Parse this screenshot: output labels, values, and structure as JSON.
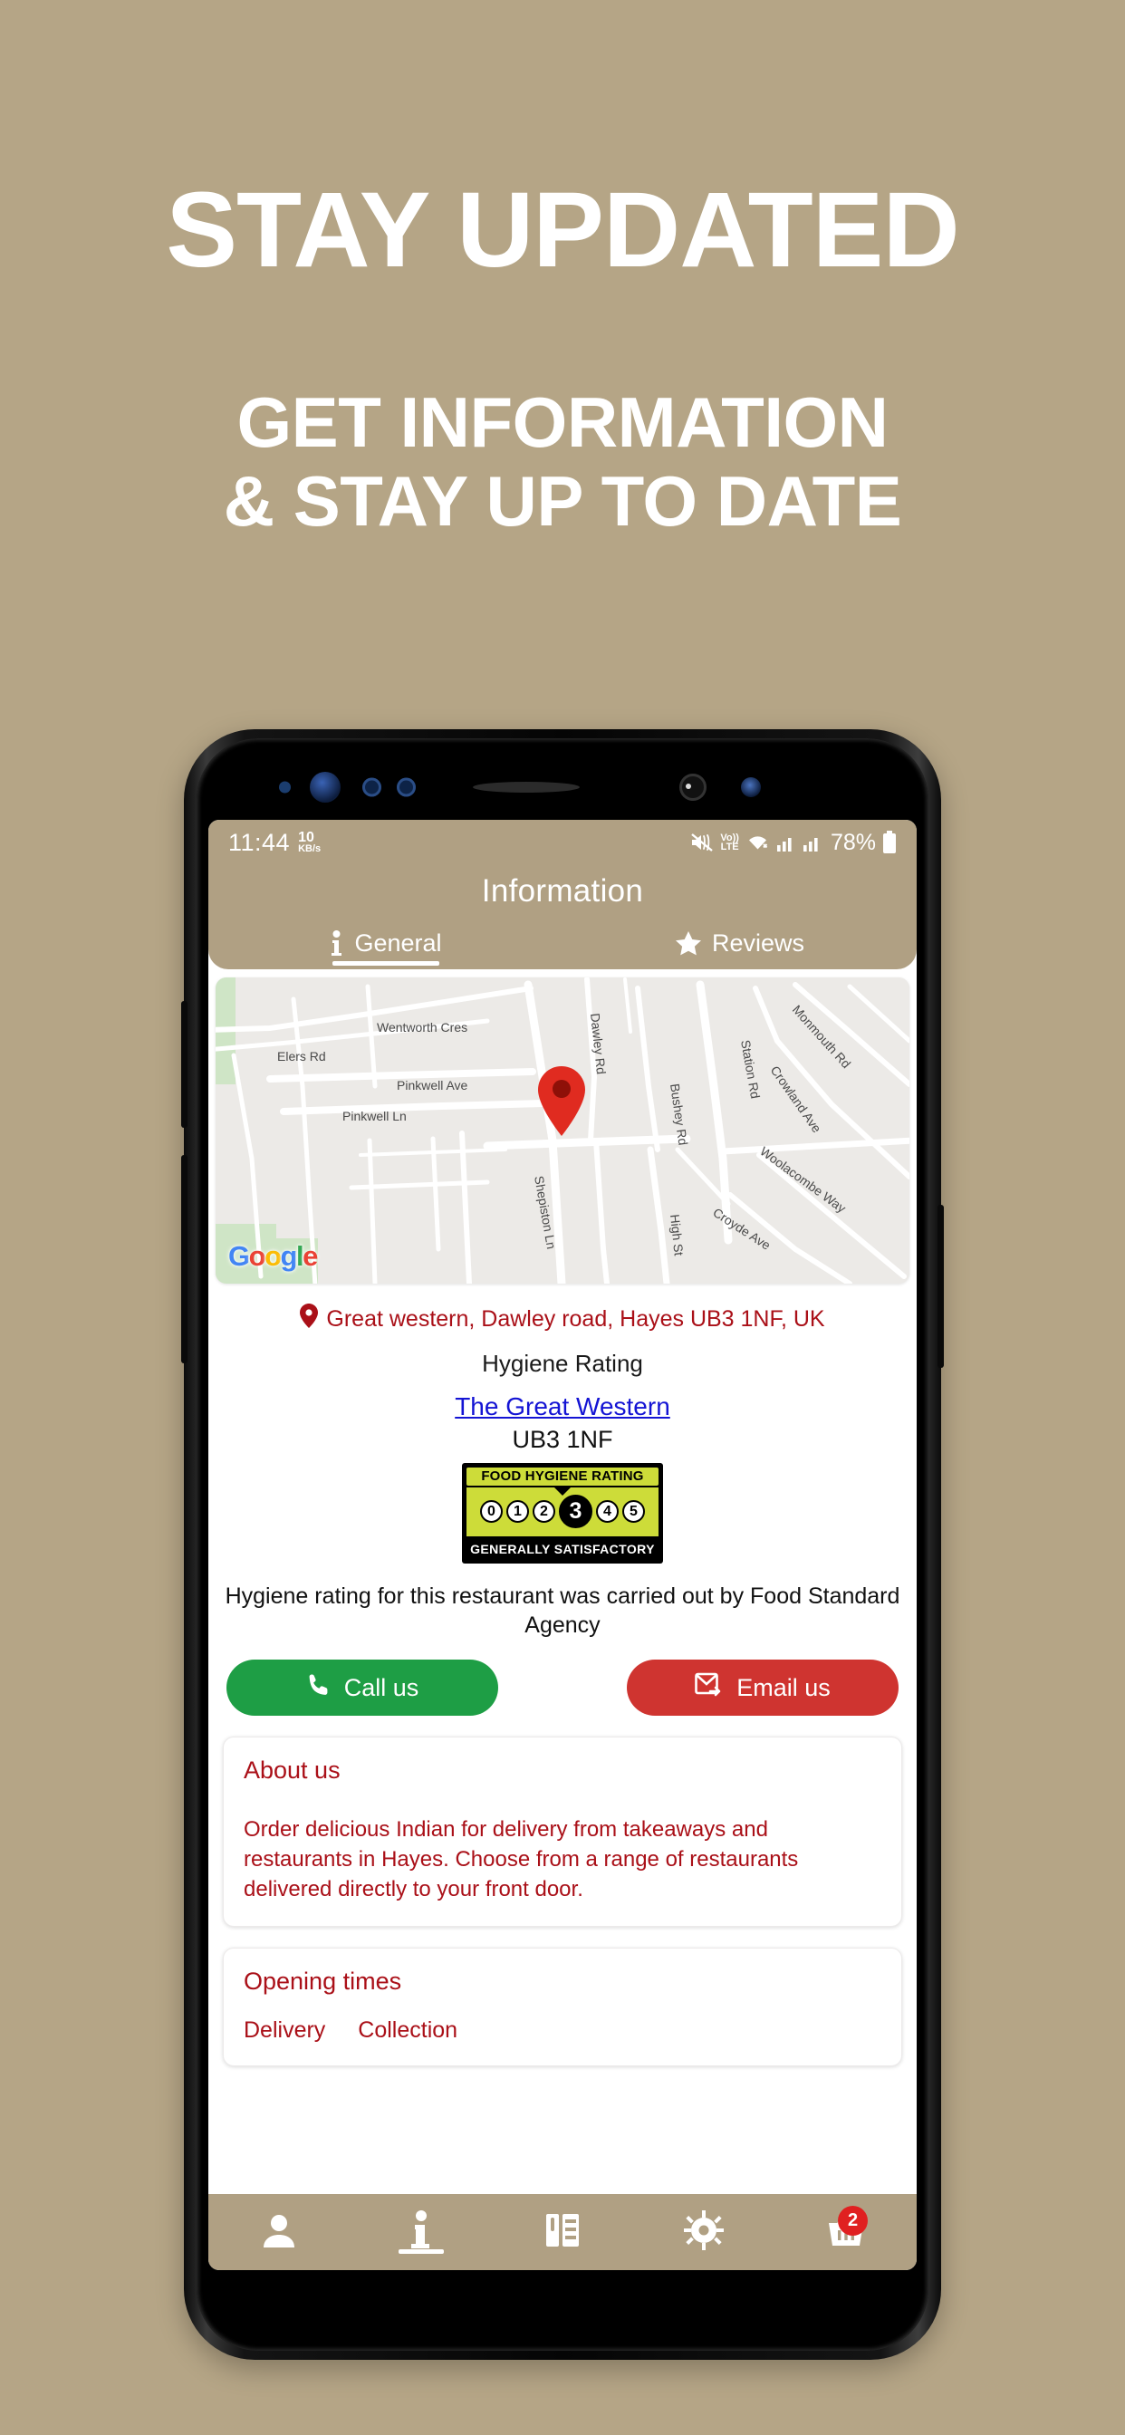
{
  "promo": {
    "headline1": "STAY UPDATED",
    "headline2_line1": "GET INFORMATION",
    "headline2_line2": "& STAY UP TO DATE"
  },
  "colors": {
    "background": "#b5a586",
    "app_bar": "#b0a083",
    "brand_red": "#aa1018",
    "call_green": "#1e9e45",
    "email_red": "#cf3430",
    "link_blue": "#1414d4",
    "badge_red": "#e02020",
    "hygiene_green": "#cddc39"
  },
  "statusbar": {
    "time": "11:44",
    "net_speed": "10",
    "net_unit": "KB/s",
    "mute_icon": "mute-icon",
    "volte_line1": "Vo))",
    "volte_line2": "LTE",
    "wifi_icon": "wifi-icon",
    "signal_icon_1": "signal-bars-icon",
    "signal_icon_2": "signal-bars-icon",
    "battery_percent": "78%",
    "battery_icon": "battery-icon"
  },
  "header": {
    "title": "Information"
  },
  "tabs": [
    {
      "label": "General",
      "icon": "info-icon",
      "active": true
    },
    {
      "label": "Reviews",
      "icon": "star-icon",
      "active": false
    }
  ],
  "map": {
    "provider_logo": "Google",
    "provider_letters": [
      "G",
      "o",
      "o",
      "g",
      "l",
      "e"
    ],
    "marker_icon": "map-pin-icon",
    "streets": [
      "Wentworth Cres",
      "Elers Rd",
      "Pinkwell Ave",
      "Pinkwell Ln",
      "Dawley Rd",
      "Bushey Rd",
      "Station Rd",
      "Monmouth Rd",
      "Crowland Ave",
      "Woolacombe Way",
      "Croyde Ave",
      "High St",
      "Shepiston Ln"
    ]
  },
  "info": {
    "address_icon": "location-pin-icon",
    "address": "Great western, Dawley road, Hayes UB3 1NF, UK",
    "hygiene_heading": "Hygiene Rating",
    "hygiene_link": "The Great Western",
    "hygiene_postcode": "UB3 1NF",
    "fsa_note": "Hygiene rating for this restaurant was carried out by Food Standard Agency"
  },
  "hygiene_badge": {
    "title": "FOOD HYGIENE RATING",
    "scale": [
      "0",
      "1",
      "2",
      "3",
      "4",
      "5"
    ],
    "selected": "3",
    "caption": "GENERALLY SATISFACTORY"
  },
  "cta": {
    "call": {
      "label": "Call us",
      "icon": "phone-icon"
    },
    "email": {
      "label": "Email us",
      "icon": "email-icon"
    }
  },
  "about": {
    "title": "About us",
    "text": "Order delicious Indian for delivery from takeaways and restaurants in Hayes. Choose from a range of restaurants delivered directly to your front door."
  },
  "opening_times": {
    "title": "Opening times",
    "modes": [
      "Delivery",
      "Collection"
    ]
  },
  "bottom_nav": [
    {
      "name": "account",
      "icon": "person-icon",
      "active": false
    },
    {
      "name": "information",
      "icon": "info-icon",
      "active": true
    },
    {
      "name": "menu",
      "icon": "menu-book-icon",
      "active": false
    },
    {
      "name": "settings",
      "icon": "gear-icon",
      "active": false
    },
    {
      "name": "basket",
      "icon": "basket-icon",
      "active": false,
      "badge": "2"
    }
  ]
}
